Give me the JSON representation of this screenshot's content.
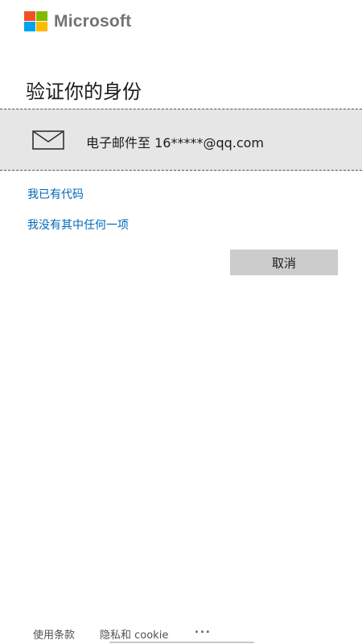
{
  "brand": {
    "name": "Microsoft",
    "logo_colors": [
      "#f25022",
      "#7fba00",
      "#00a4ef",
      "#ffb900"
    ]
  },
  "page": {
    "title": "验证你的身份"
  },
  "verification_options": [
    {
      "icon": "envelope-icon",
      "label": "电子邮件至 16*****@qq.com"
    }
  ],
  "links": {
    "have_code": "我已有代码",
    "none_of_these": "我没有其中任何一项"
  },
  "buttons": {
    "cancel": "取消"
  },
  "footer": {
    "terms": "使用条款",
    "privacy": "隐私和 cookie",
    "more": "..."
  },
  "colors": {
    "link": "#0067b8",
    "option_bg": "#e6e6e6",
    "button_bg": "#cccccc"
  }
}
